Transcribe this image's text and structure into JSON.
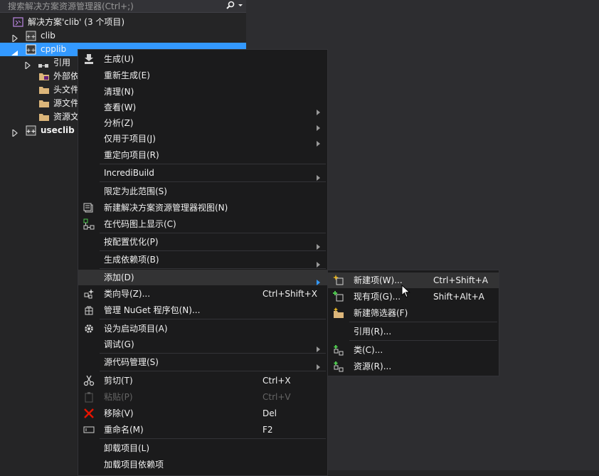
{
  "search": {
    "placeholder": "搜索解决方案资源管理器(Ctrl+;)"
  },
  "tree": {
    "solution": "解决方案'clib' (3 个项目)",
    "items": [
      {
        "label": "clib"
      },
      {
        "label": "cpplib"
      },
      {
        "label": "引用"
      },
      {
        "label": "外部依"
      },
      {
        "label": "头文件"
      },
      {
        "label": "源文件"
      },
      {
        "label": "资源文"
      },
      {
        "label": "useclib"
      }
    ]
  },
  "context_menu": {
    "items": [
      {
        "label": "生成(U)"
      },
      {
        "label": "重新生成(E)"
      },
      {
        "label": "清理(N)"
      },
      {
        "label": "查看(W)"
      },
      {
        "label": "分析(Z)"
      },
      {
        "label": "仅用于项目(J)"
      },
      {
        "label": "重定向项目(R)"
      },
      {
        "label": "IncrediBuild"
      },
      {
        "label": "限定为此范围(S)"
      },
      {
        "label": "新建解决方案资源管理器视图(N)"
      },
      {
        "label": "在代码图上显示(C)"
      },
      {
        "label": "按配置优化(P)"
      },
      {
        "label": "生成依赖项(B)"
      },
      {
        "label": "添加(D)"
      },
      {
        "label": "类向导(Z)...",
        "shortcut": "Ctrl+Shift+X"
      },
      {
        "label": "管理 NuGet 程序包(N)..."
      },
      {
        "label": "设为启动项目(A)"
      },
      {
        "label": "调试(G)"
      },
      {
        "label": "源代码管理(S)"
      },
      {
        "label": "剪切(T)",
        "shortcut": "Ctrl+X"
      },
      {
        "label": "粘贴(P)",
        "shortcut": "Ctrl+V"
      },
      {
        "label": "移除(V)",
        "shortcut": "Del"
      },
      {
        "label": "重命名(M)",
        "shortcut": "F2"
      },
      {
        "label": "卸载项目(L)"
      },
      {
        "label": "加载项目依赖项"
      }
    ]
  },
  "submenu": {
    "items": [
      {
        "label": "新建项(W)...",
        "shortcut": "Ctrl+Shift+A"
      },
      {
        "label": "现有项(G)...",
        "shortcut": "Shift+Alt+A"
      },
      {
        "label": "新建筛选器(F)"
      },
      {
        "label": "引用(R)..."
      },
      {
        "label": "类(C)..."
      },
      {
        "label": "资源(R)..."
      }
    ]
  },
  "colors": {
    "selection": "#3399ff",
    "menu_bg": "#1b1b1c",
    "menu_hover": "#333334",
    "remove_icon": "#e51400",
    "add_icon": "#e6b422"
  }
}
